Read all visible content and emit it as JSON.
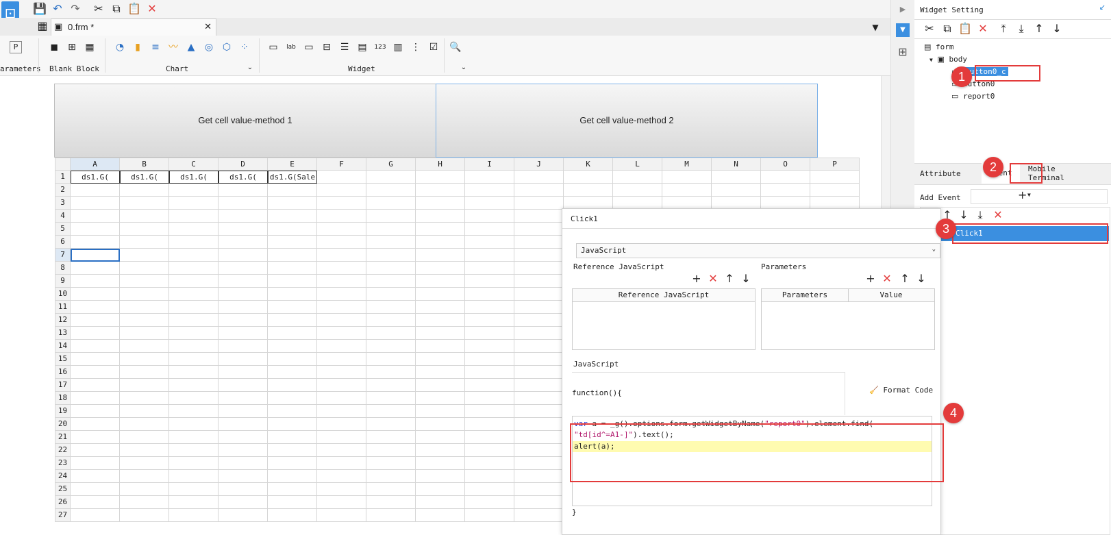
{
  "file_tab": {
    "name": "0.frm *"
  },
  "ribbon": {
    "groups": [
      {
        "label": "arameters",
        "icon": "parameter-icon"
      },
      {
        "label": "Blank Block"
      },
      {
        "label": "Chart"
      },
      {
        "label": "Widget"
      }
    ],
    "param_glyph": "P"
  },
  "buttons": [
    {
      "label": "Get cell value-method 1"
    },
    {
      "label": "Get cell value-method 2"
    }
  ],
  "grid": {
    "columns": [
      "A",
      "B",
      "C",
      "D",
      "E",
      "F",
      "G",
      "H",
      "I",
      "J",
      "K",
      "L",
      "M",
      "N",
      "O",
      "P"
    ],
    "rows": [
      "1",
      "2",
      "3",
      "4",
      "5",
      "6",
      "7",
      "8",
      "9",
      "10",
      "11",
      "12",
      "13",
      "14",
      "15",
      "16",
      "17",
      "18",
      "19",
      "20",
      "21",
      "22",
      "23",
      "24",
      "25",
      "26",
      "27"
    ],
    "row1_cells": [
      "ds1.G(",
      "ds1.G(",
      "ds1.G(",
      "ds1.G(",
      "ds1.G(Sale"
    ]
  },
  "widget_setting": {
    "title": "Widget Setting",
    "tree": {
      "form": "form",
      "body": "body",
      "items": [
        "button0_c",
        "button0",
        "report0"
      ]
    },
    "tabs": {
      "attribute": "Attribute",
      "event": "Event",
      "mobile": "Mobile Terminal"
    },
    "add_event_label": "Add Event",
    "events": [
      "Click1"
    ]
  },
  "dialog": {
    "title": "Click1",
    "type_select": "JavaScript",
    "ref_js_label": "Reference JavaScript",
    "params_label": "Parameters",
    "ref_js_col": "Reference JavaScript",
    "params_col": "Parameters",
    "value_col": "Value",
    "js_label": "JavaScript",
    "func_header": "function(){",
    "format_code": "Format Code",
    "code": {
      "line1_kw": "var",
      "line1_a": " a = _g().options.form.getWidgetByName(",
      "line1_str": "\"report0\"",
      "line1_b": ").element.find(",
      "line2_str": "\"td[id^=A1-]\"",
      "line2_b": ").text();",
      "line3": "alert(a);"
    },
    "closing": "}"
  },
  "badges": [
    "1",
    "2",
    "3",
    "4"
  ],
  "colors": {
    "accent": "#1d7fd6",
    "highlight": "#e33b3b",
    "selected": "#3b8fe0"
  }
}
